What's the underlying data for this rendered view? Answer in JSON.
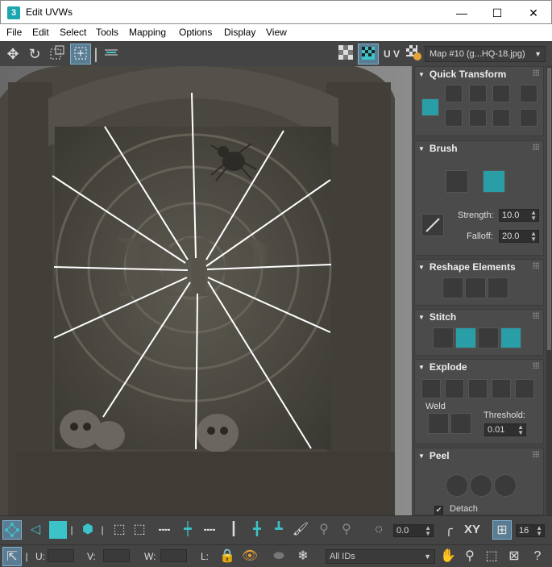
{
  "window": {
    "app_icon_text": "3",
    "title": "Edit UVWs",
    "minimize": "—",
    "maximize": "☐",
    "close": "✕"
  },
  "menu": [
    "File",
    "Edit",
    "Select",
    "Tools",
    "Mapping",
    "Options",
    "Display",
    "View"
  ],
  "toolbar": {
    "uv_label": "U V",
    "map_dropdown": "Map #10 (g...HQ-18.jpg)"
  },
  "panel": {
    "quick_transform": {
      "title": "Quick Transform"
    },
    "brush": {
      "title": "Brush",
      "strength_label": "Strength:",
      "strength_value": "10.0",
      "falloff_label": "Falloff:",
      "falloff_value": "20.0"
    },
    "reshape": {
      "title": "Reshape Elements"
    },
    "stitch": {
      "title": "Stitch"
    },
    "explode": {
      "title": "Explode",
      "weld_label": "Weld",
      "threshold_label": "Threshold:",
      "threshold_value": "0.01"
    },
    "peel": {
      "title": "Peel",
      "detach_label": "Detach",
      "detach_checked": true
    }
  },
  "bottom": {
    "spinner_value": "0.0",
    "xy_label": "XY",
    "snap_value": "16",
    "u_label": "U:",
    "v_label": "V:",
    "w_label": "W:",
    "l_label": "L:",
    "ids_dropdown": "All IDs"
  },
  "colors": {
    "accent_teal": "#3cc3c9",
    "active_button": "#5b7d93",
    "panel_bg": "#444444"
  }
}
